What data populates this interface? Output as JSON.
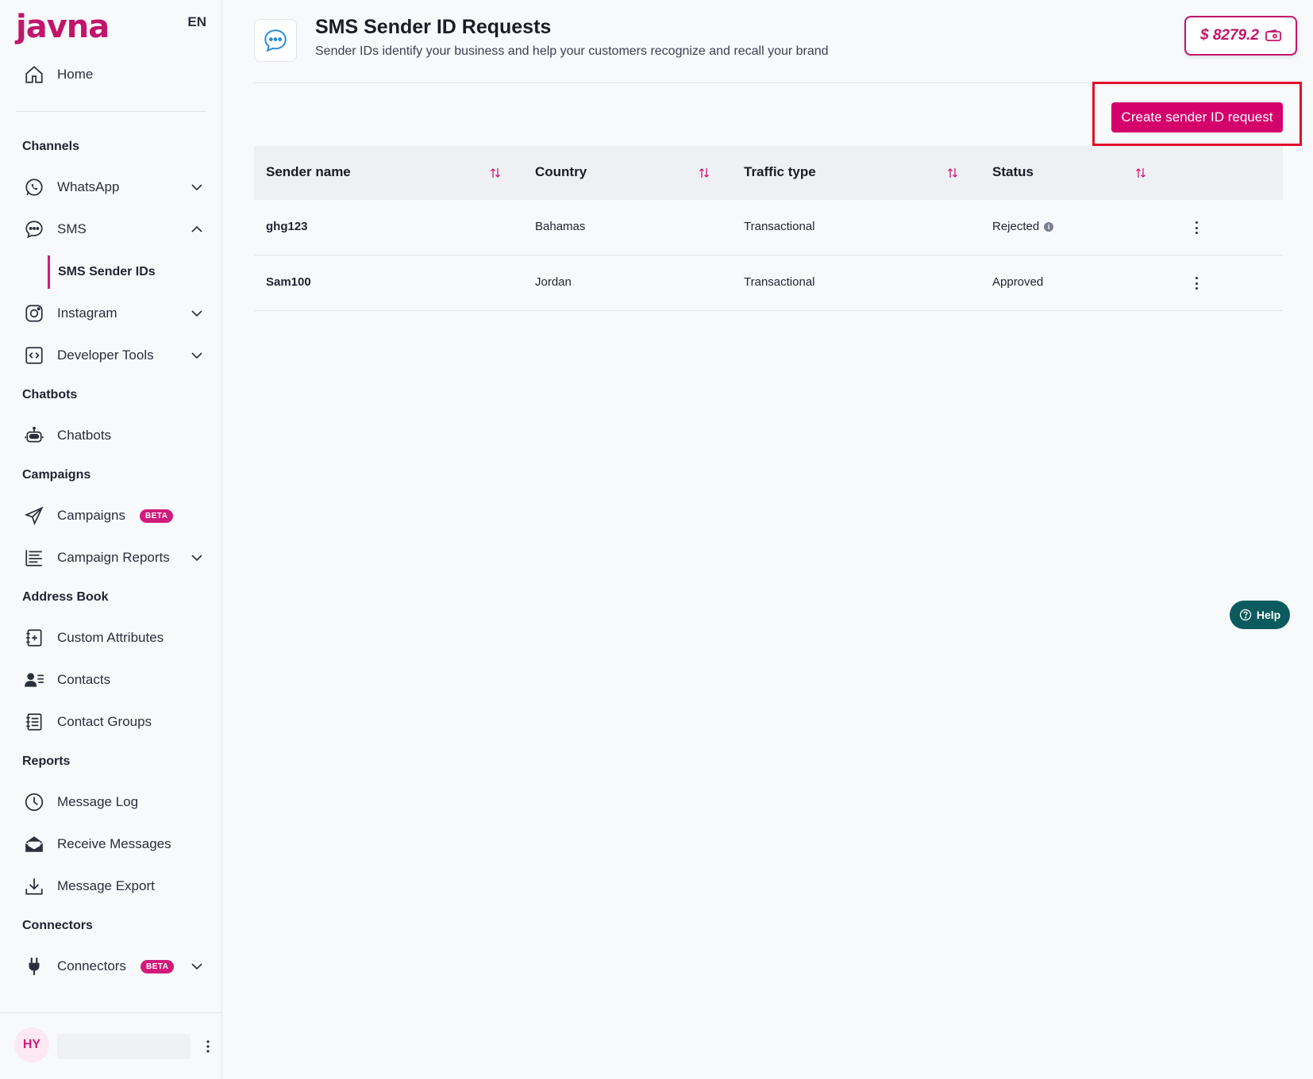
{
  "brand": {
    "logo_text": "javna",
    "language": "EN",
    "accent": "#d4006b"
  },
  "sidebar": {
    "home": "Home",
    "sections": {
      "channels": "Channels",
      "chatbots": "Chatbots",
      "campaigns": "Campaigns",
      "address_book": "Address Book",
      "reports": "Reports",
      "connectors": "Connectors"
    },
    "items": {
      "whatsapp": "WhatsApp",
      "sms": "SMS",
      "sms_sender_ids": "SMS Sender IDs",
      "instagram": "Instagram",
      "developer_tools": "Developer Tools",
      "chatbots": "Chatbots",
      "campaigns": "Campaigns",
      "campaign_reports": "Campaign Reports",
      "custom_attributes": "Custom Attributes",
      "contacts": "Contacts",
      "contact_groups": "Contact Groups",
      "message_log": "Message Log",
      "receive_messages": "Receive Messages",
      "message_export": "Message Export",
      "connectors": "Connectors"
    },
    "beta_label": "BETA",
    "user_initials": "HY"
  },
  "header": {
    "title": "SMS Sender ID Requests",
    "subtitle": "Sender IDs identify your business and help your customers recognize and recall your brand",
    "balance": "$ 8279.2"
  },
  "actions": {
    "create_button": "Create sender ID request"
  },
  "table": {
    "columns": [
      "Sender name",
      "Country",
      "Traffic type",
      "Status"
    ],
    "rows": [
      {
        "sender": "ghg123",
        "country": "Bahamas",
        "traffic": "Transactional",
        "status": "Rejected"
      },
      {
        "sender": "Sam100",
        "country": "Jordan",
        "traffic": "Transactional",
        "status": "Approved"
      }
    ]
  },
  "help": {
    "label": "Help"
  }
}
